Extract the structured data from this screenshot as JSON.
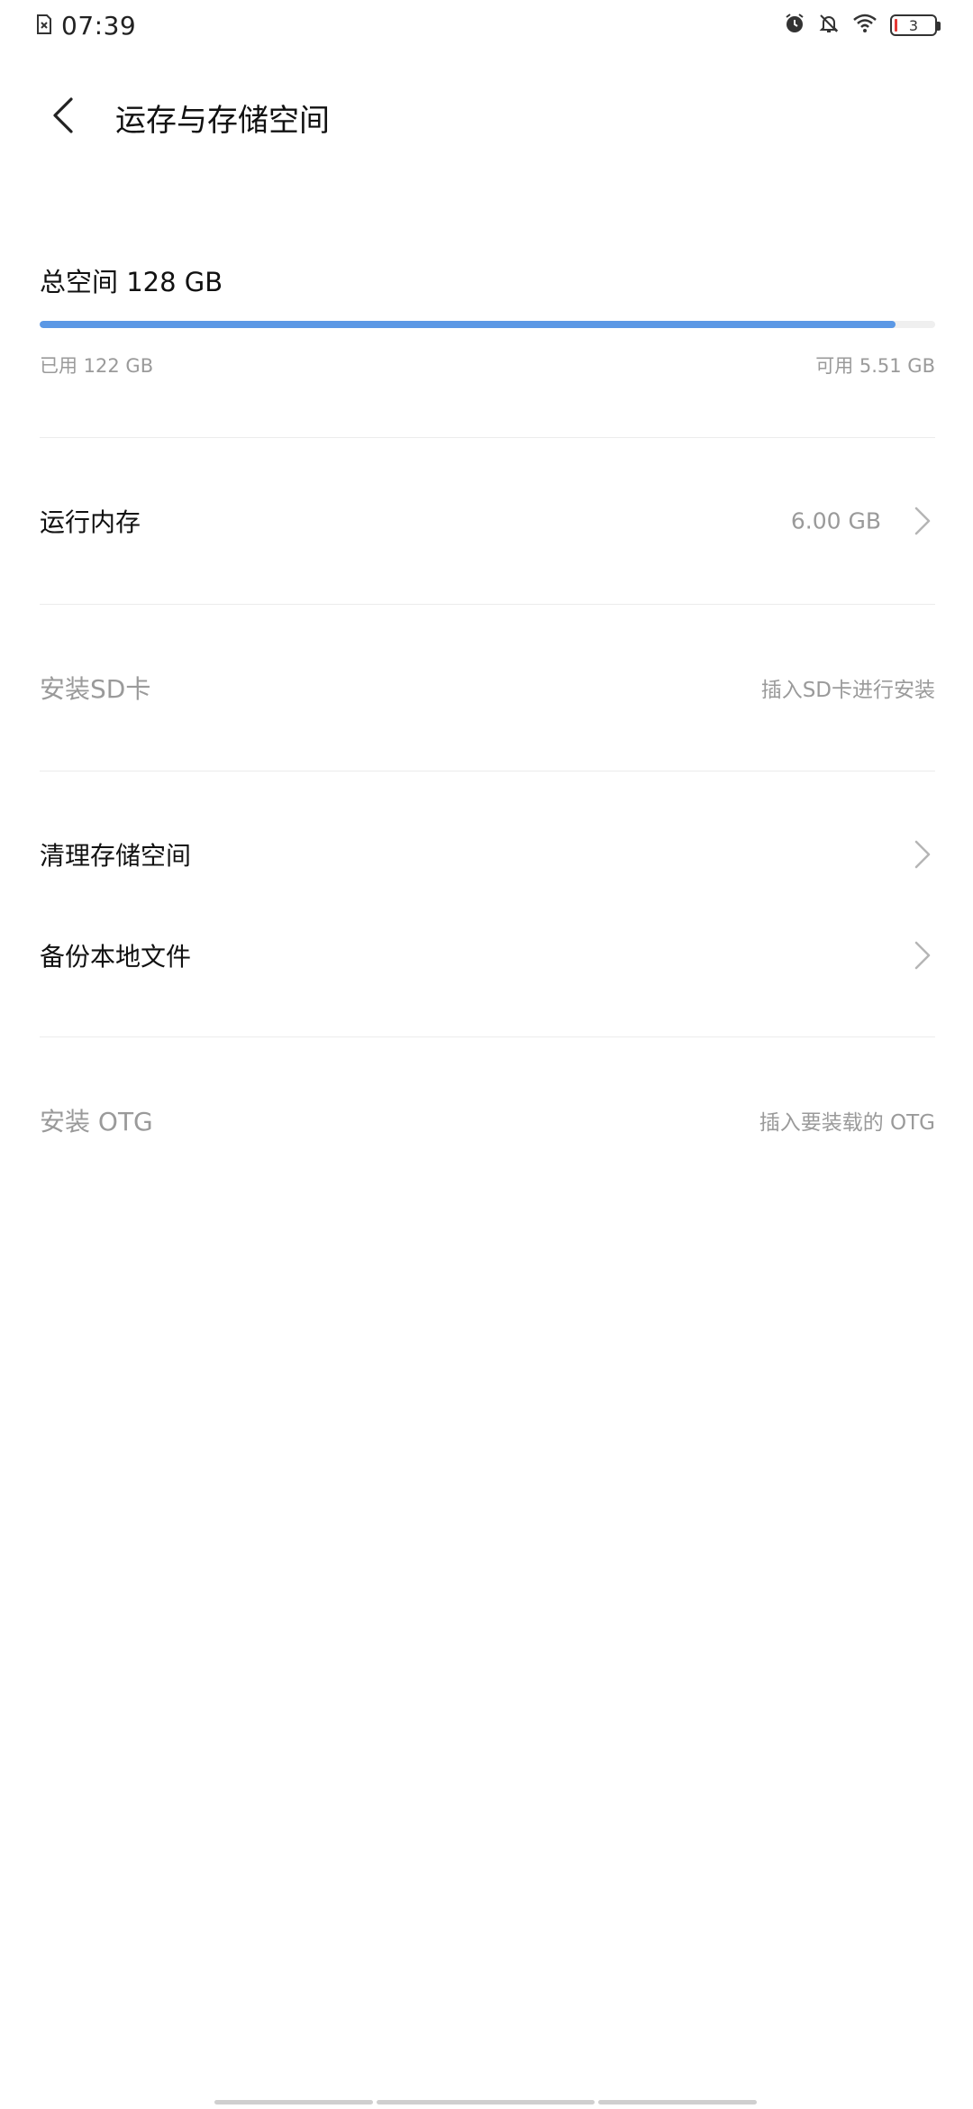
{
  "status_bar": {
    "time": "07:39",
    "battery_level": "3",
    "icons": [
      "sim-error-icon",
      "alarm-icon",
      "bell-off-icon",
      "wifi-icon",
      "battery-icon"
    ]
  },
  "header": {
    "title": "运存与存储空间",
    "back_icon": "chevron-left-icon"
  },
  "storage": {
    "total_label": "总空间 128 GB",
    "used_label": "已用 122 GB",
    "available_label": "可用 5.51 GB",
    "used_fraction": 0.956,
    "bar_color": "#5b98e5"
  },
  "rows": {
    "ram": {
      "label": "运行内存",
      "value": "6.00 GB"
    },
    "sd_card": {
      "label": "安装SD卡",
      "hint": "插入SD卡进行安装"
    },
    "clean": {
      "label": "清理存储空间"
    },
    "backup": {
      "label": "备份本地文件"
    },
    "otg": {
      "label": "安装 OTG",
      "hint": "插入要装载的 OTG"
    }
  }
}
